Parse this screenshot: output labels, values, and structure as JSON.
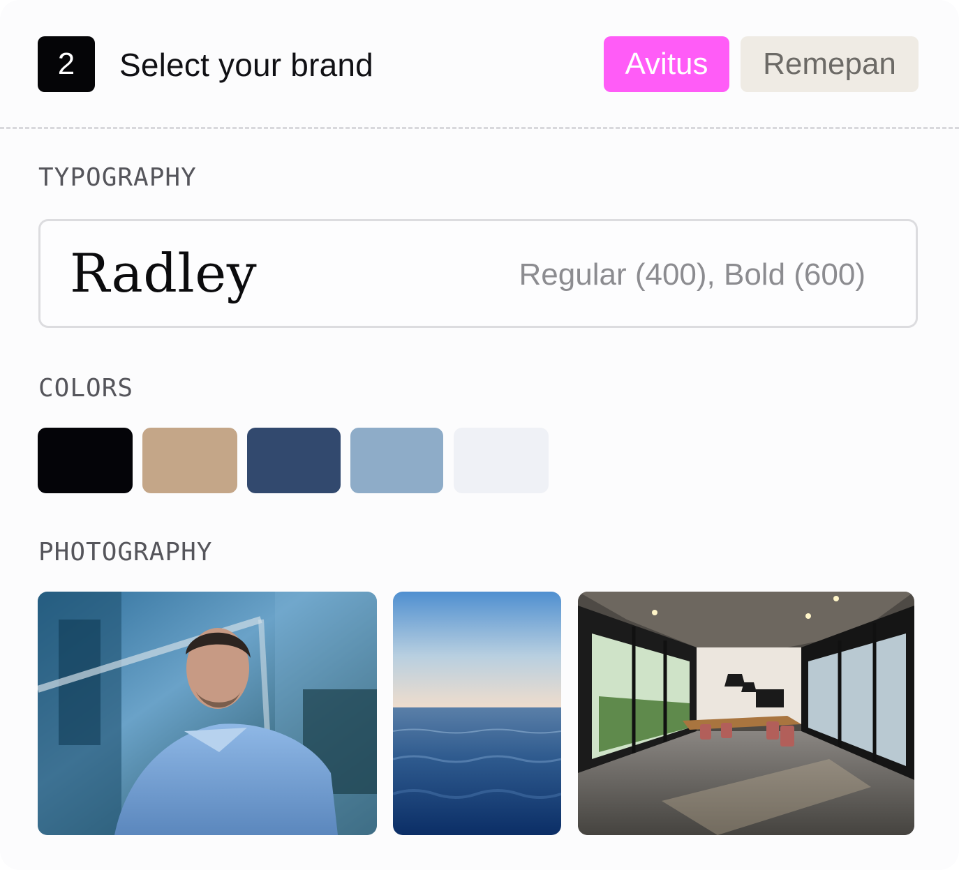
{
  "step": {
    "number": "2",
    "title": "Select your brand"
  },
  "brands": [
    {
      "label": "Avitus",
      "selected": true,
      "color": "#ff5cf7"
    },
    {
      "label": "Remepan",
      "selected": false,
      "color": "#efebe4"
    }
  ],
  "sections": {
    "typography": "TYPOGRAPHY",
    "colors": "COLORS",
    "photography": "PHOTOGRAPHY"
  },
  "typography": {
    "font_name": "Radley",
    "weights": "Regular (400), Bold (600)"
  },
  "colors": [
    "#040408",
    "#c4a688",
    "#32496e",
    "#8eacc8",
    "#eff1f6"
  ],
  "photos": [
    {
      "subject": "man-in-blue-shirt-photo"
    },
    {
      "subject": "sea-horizon-photo"
    },
    {
      "subject": "office-meeting-room-photo"
    }
  ]
}
